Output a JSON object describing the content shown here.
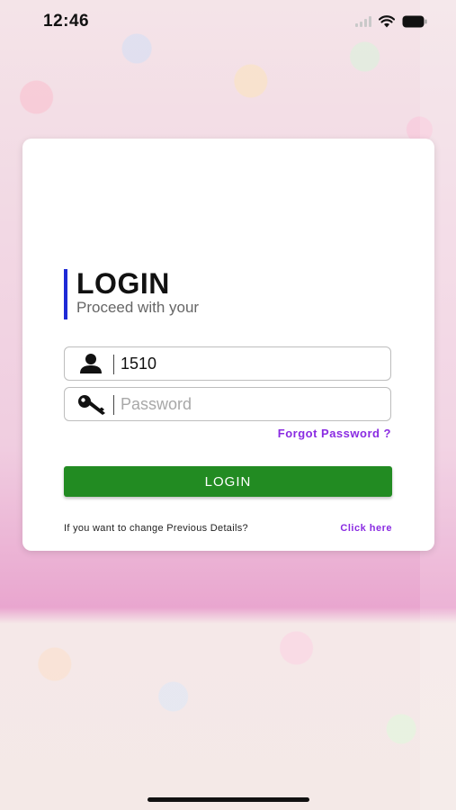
{
  "status_bar": {
    "time": "12:46",
    "icons": [
      "signal-icon",
      "wifi-icon",
      "battery-icon"
    ]
  },
  "login_card": {
    "title": "LOGIN",
    "subtitle": "Proceed with your",
    "username": {
      "value": "1510",
      "icon": "user-icon"
    },
    "password": {
      "value": "",
      "placeholder": "Password",
      "icon": "key-icon"
    },
    "forgot_password_label": "Forgot Password ?",
    "login_button_label": "LOGIN",
    "change_details_text": "If you want to change Previous Details?",
    "click_here_label": "Click here"
  },
  "colors": {
    "accent_bar": "#1e2ad6",
    "login_button": "#228b22",
    "link": "#8a2be2"
  }
}
